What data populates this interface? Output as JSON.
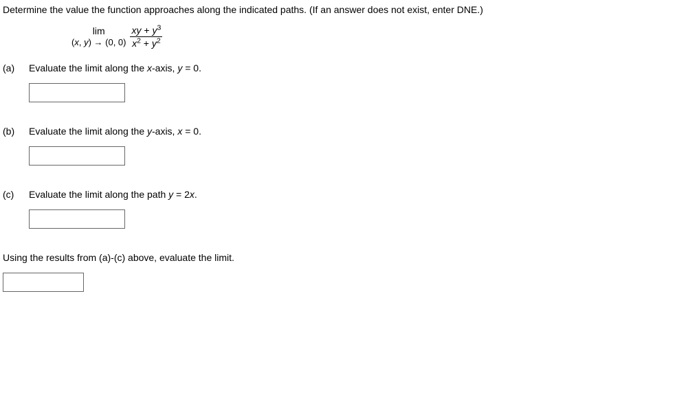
{
  "intro": "Determine the value the function approaches along the indicated paths. (If an answer does not exist, enter DNE.)",
  "limit": {
    "lim_label": "lim",
    "approach_prefix": "(",
    "var_x": "x",
    "comma_sep": ", ",
    "var_y": "y",
    "approach_suffix": ") → (0, 0)",
    "num_part1": "xy",
    "num_plus": " + ",
    "num_var": "y",
    "num_exp": "3",
    "den_var1": "x",
    "den_exp1": "2",
    "den_plus": " + ",
    "den_var2": "y",
    "den_exp2": "2"
  },
  "parts": {
    "a": {
      "label": "(a)",
      "prefix": "Evaluate the limit along the ",
      "axis_var": "x",
      "axis_rest": "-axis, ",
      "cond_var": "y",
      "cond_rest": " = 0."
    },
    "b": {
      "label": "(b)",
      "prefix": "Evaluate the limit along the ",
      "axis_var": "y",
      "axis_rest": "-axis, ",
      "cond_var": "x",
      "cond_rest": " = 0."
    },
    "c": {
      "label": "(c)",
      "prefix": "Evaluate the limit along the path ",
      "cond_var": "y",
      "cond_mid": " = 2",
      "cond_var2": "x",
      "cond_end": "."
    }
  },
  "final": {
    "prompt": "Using the results from (a)-(c) above, evaluate the limit."
  }
}
